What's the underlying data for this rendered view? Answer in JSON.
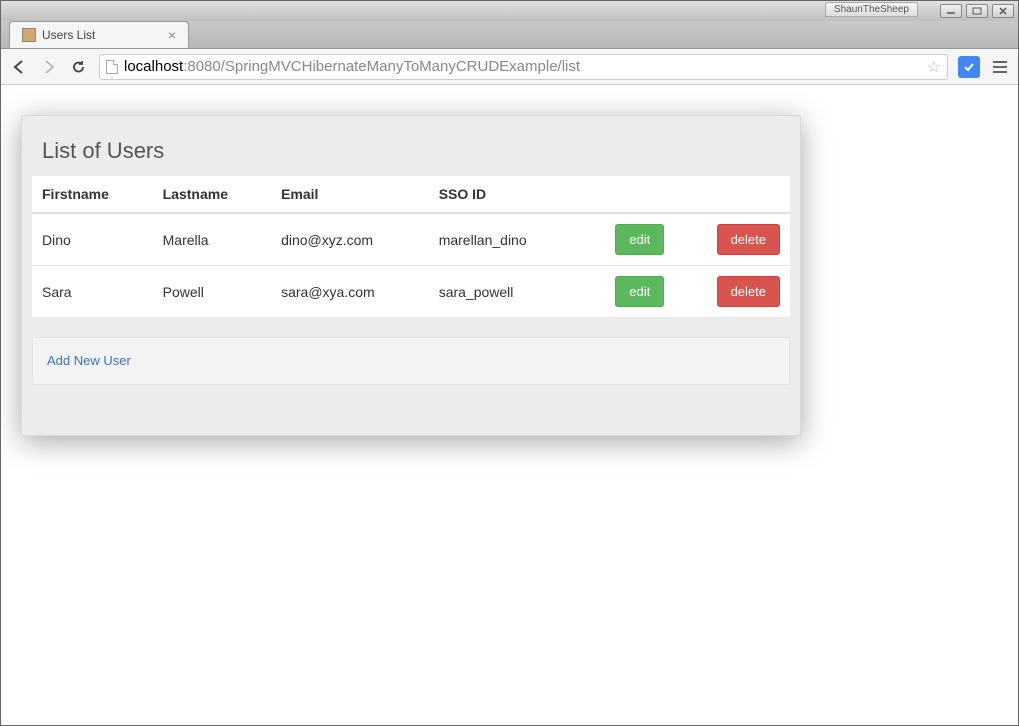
{
  "window": {
    "user_label": "ShaunTheSheep"
  },
  "tab": {
    "title": "Users List"
  },
  "url": {
    "protocol": "",
    "hostname": "localhost",
    "port": ":8080",
    "path": "/SpringMVCHibernateManyToManyCRUDExample/list"
  },
  "page": {
    "heading": "List of Users",
    "columns": [
      "Firstname",
      "Lastname",
      "Email",
      "SSO ID",
      "",
      ""
    ],
    "rows": [
      {
        "firstname": "Dino",
        "lastname": "Marella",
        "email": "dino@xyz.com",
        "sso": "marellan_dino"
      },
      {
        "firstname": "Sara",
        "lastname": "Powell",
        "email": "sara@xya.com",
        "sso": "sara_powell"
      }
    ],
    "edit_label": "edit",
    "delete_label": "delete",
    "add_link": "Add New User"
  }
}
